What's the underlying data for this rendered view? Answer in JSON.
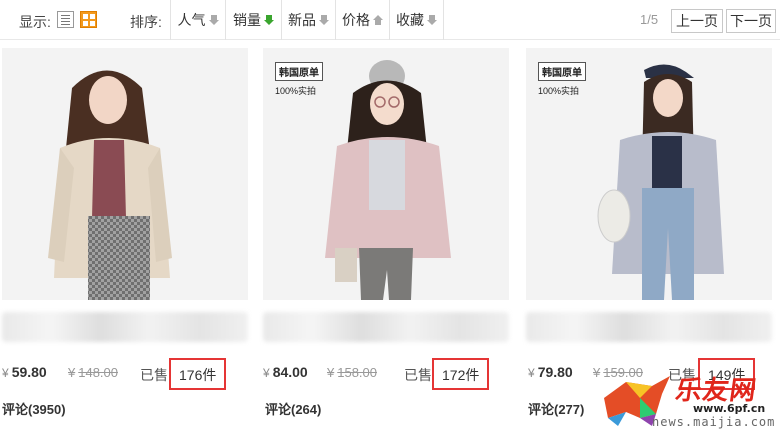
{
  "toolbar": {
    "display_label": "显示:",
    "sort_label": "排序:",
    "sort_items": [
      {
        "label": "人气",
        "arrow": "down",
        "active": false
      },
      {
        "label": "销量",
        "arrow": "down",
        "active": true
      },
      {
        "label": "新品",
        "arrow": "down",
        "active": false
      },
      {
        "label": "价格",
        "arrow": "up",
        "active": false
      },
      {
        "label": "收藏",
        "arrow": "down",
        "active": false
      }
    ],
    "page_indicator": "1/5",
    "prev_label": "上一页",
    "next_label": "下一页",
    "view_modes": [
      "list-view-icon",
      "grid-view-icon"
    ],
    "active_view": "grid"
  },
  "products": [
    {
      "badge": "",
      "badge_sub": "",
      "price": "59.80",
      "old_price": "148.00",
      "sold_label": "已售",
      "sold_count": "176件",
      "comments": "评论(3950)"
    },
    {
      "badge": "韩国原单",
      "badge_sub": "100%实拍",
      "price": "84.00",
      "old_price": "158.00",
      "sold_label": "已售",
      "sold_count": "172件",
      "comments": "评论(264)"
    },
    {
      "badge": "韩国原单",
      "badge_sub": "100%实拍",
      "price": "79.80",
      "old_price": "159.00",
      "sold_label": "已售",
      "sold_count": "149件",
      "comments": "评论(277)"
    }
  ],
  "currency_symbol": "¥",
  "watermark": {
    "site_cn": "乐友网",
    "domain1": "www.6pf.cn",
    "domain2": "news.maijia.com"
  },
  "colors": {
    "highlight_border": "#e53535",
    "active_arrow": "#3aa52e",
    "grid_icon": "#f39a1e",
    "watermark_red": "#e0261b"
  }
}
